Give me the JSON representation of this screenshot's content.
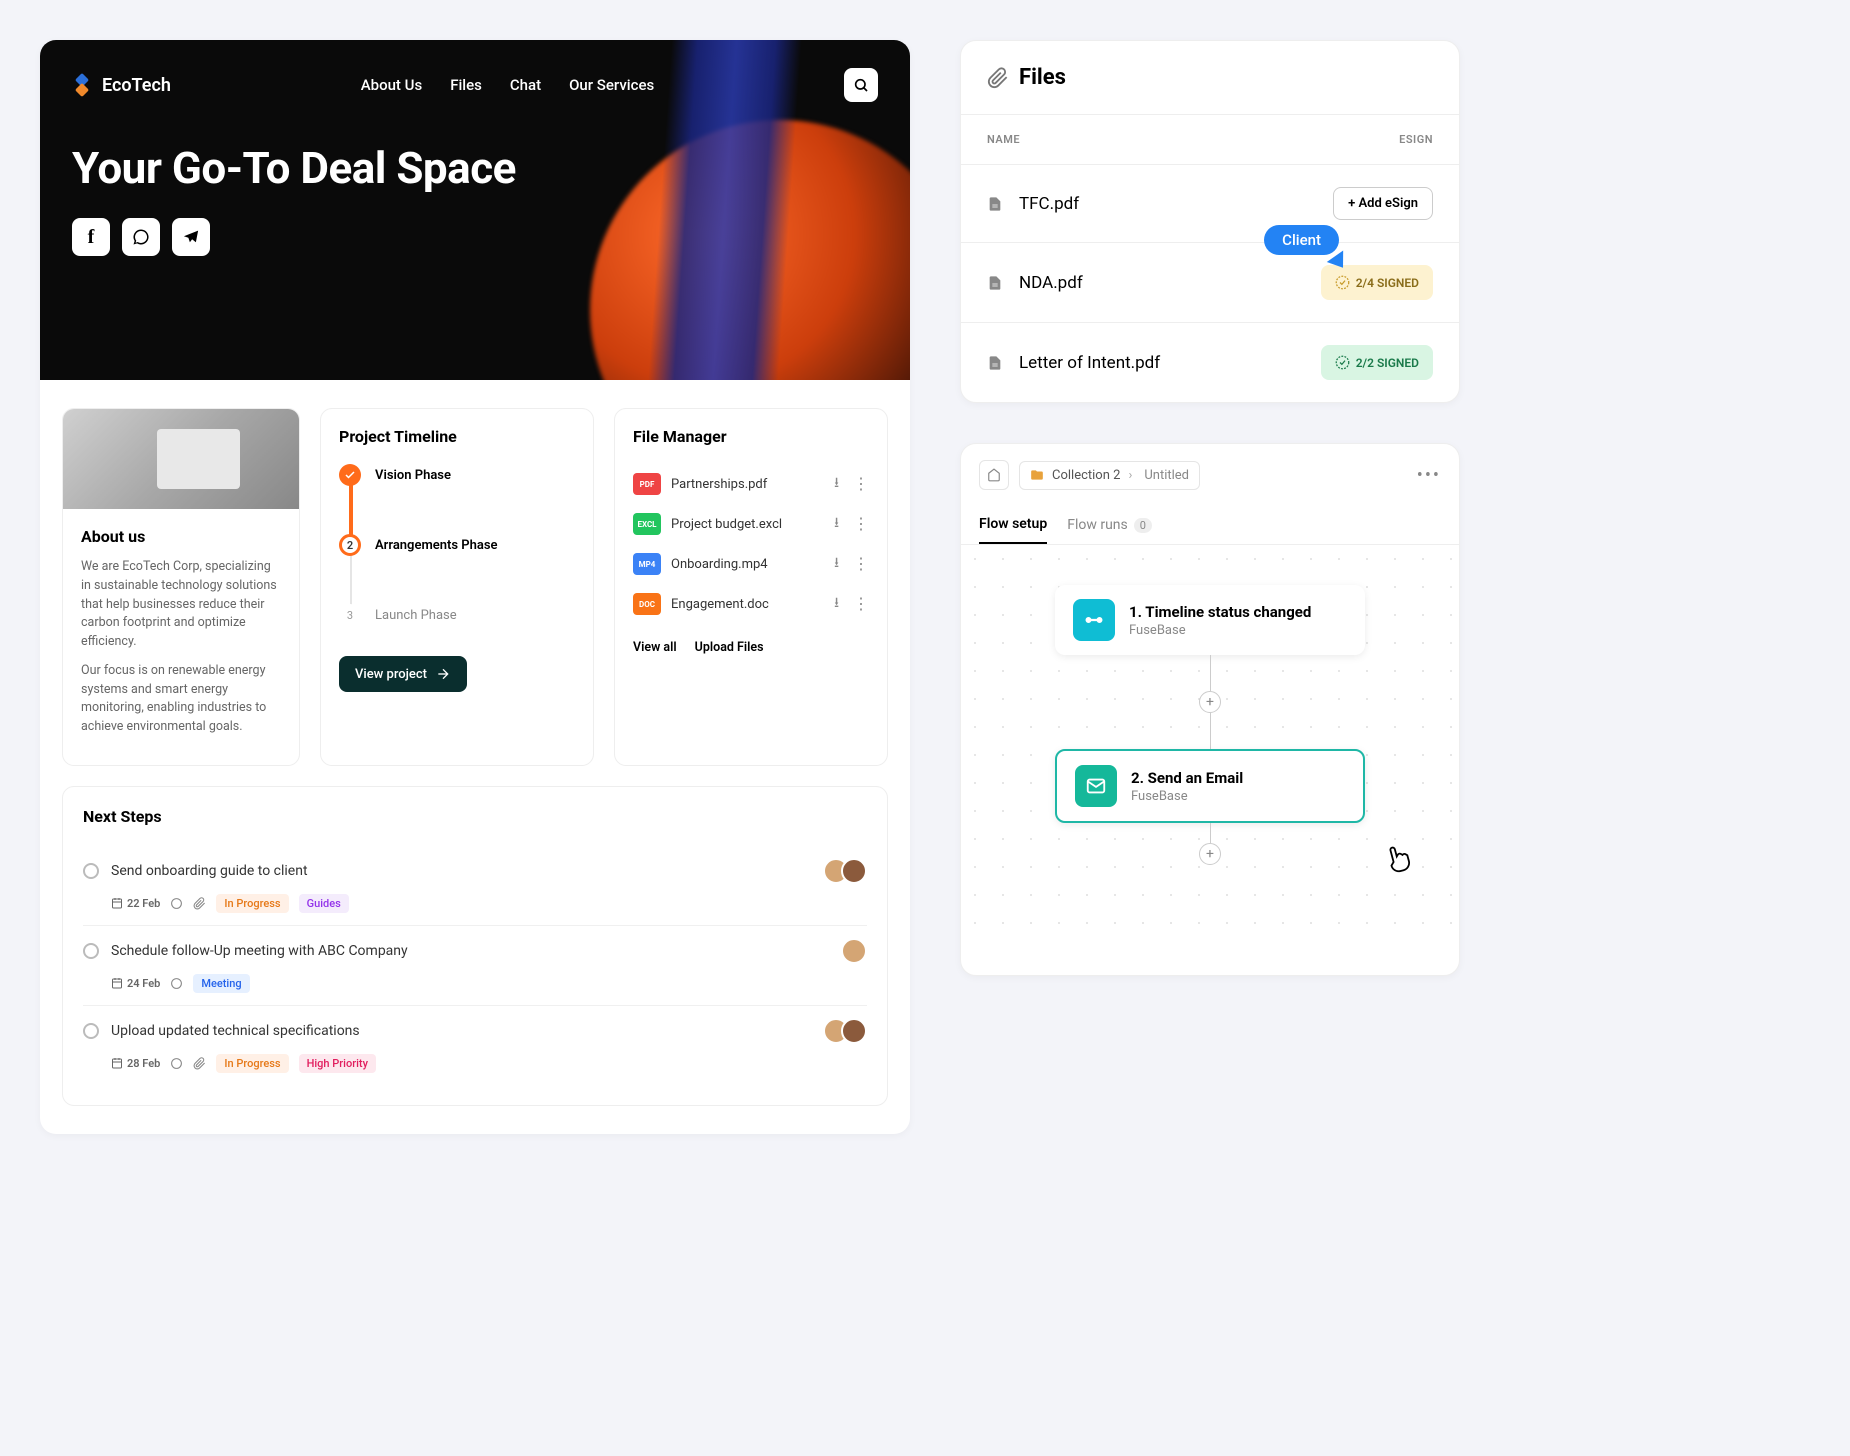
{
  "hero": {
    "brand": "EcoTech",
    "nav": [
      "About Us",
      "Files",
      "Chat",
      "Our Services"
    ],
    "headline": "Your Go-To Deal Space"
  },
  "about": {
    "title": "About us",
    "p1": "We are EcoTech Corp, specializing in sustainable technology solutions that help businesses reduce their carbon footprint and optimize efficiency.",
    "p2": "Our focus is on renewable energy systems and smart energy monitoring, enabling industries to achieve environmental goals."
  },
  "timeline": {
    "title": "Project Timeline",
    "phases": [
      {
        "label": "Vision Phase",
        "num": "✓"
      },
      {
        "label": "Arrangements Phase",
        "num": "2"
      },
      {
        "label": "Launch Phase",
        "num": "3"
      }
    ],
    "button": "View project"
  },
  "fileManager": {
    "title": "File Manager",
    "files": [
      {
        "name": "Partnerships.pdf",
        "ext": "PDF",
        "color": "#ef4444"
      },
      {
        "name": "Project budget.excl",
        "ext": "EXCL",
        "color": "#22c55e"
      },
      {
        "name": "Onboarding.mp4",
        "ext": "MP4",
        "color": "#3b82f6"
      },
      {
        "name": "Engagement.doc",
        "ext": "DOC",
        "color": "#f97316"
      }
    ],
    "viewAll": "View all",
    "upload": "Upload Files"
  },
  "nextSteps": {
    "title": "Next Steps",
    "items": [
      {
        "title": "Send onboarding guide to client",
        "date": "22 Feb",
        "tags": [
          {
            "t": "In Progress",
            "c": "orange"
          },
          {
            "t": "Guides",
            "c": "purple"
          }
        ],
        "avatars": 2,
        "clip": true
      },
      {
        "title": "Schedule follow-Up meeting with ABC Company",
        "date": "24 Feb",
        "tags": [
          {
            "t": "Meeting",
            "c": "blue"
          }
        ],
        "avatars": 1,
        "clip": false
      },
      {
        "title": "Upload updated technical specifications",
        "date": "28 Feb",
        "tags": [
          {
            "t": "In Progress",
            "c": "orange"
          },
          {
            "t": "High Priority",
            "c": "red"
          }
        ],
        "avatars": 2,
        "clip": true
      }
    ]
  },
  "filesPanel": {
    "title": "Files",
    "cols": {
      "name": "NAME",
      "esign": "ESIGN"
    },
    "clientLabel": "Client",
    "rows": [
      {
        "name": "TFC.pdf",
        "action": {
          "type": "button",
          "label": "+ Add eSign"
        }
      },
      {
        "name": "NDA.pdf",
        "action": {
          "type": "badge",
          "label": "2/4 SIGNED",
          "style": "yellow"
        }
      },
      {
        "name": "Letter of Intent.pdf",
        "action": {
          "type": "badge",
          "label": "2/2 SIGNED",
          "style": "green"
        }
      }
    ]
  },
  "flow": {
    "collection": "Collection 2",
    "untitled": "Untitled",
    "tabs": {
      "setup": "Flow setup",
      "runs": "Flow runs",
      "runsCount": "0"
    },
    "nodes": [
      {
        "title": "1.  Timeline status changed",
        "sub": "FuseBase",
        "icon": "timeline"
      },
      {
        "title": "2.  Send an Email",
        "sub": "FuseBase",
        "icon": "email"
      }
    ]
  }
}
